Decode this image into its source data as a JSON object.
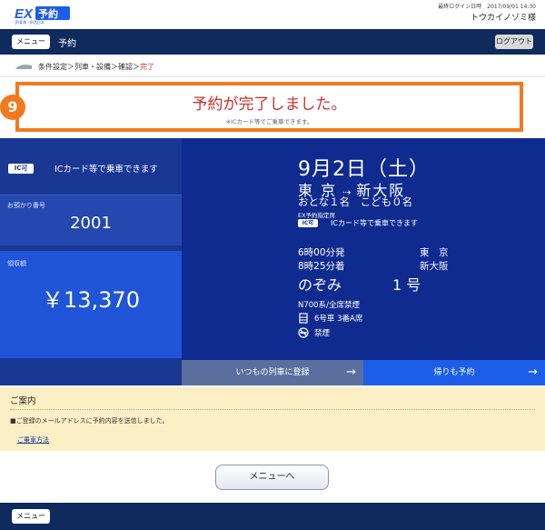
{
  "header": {
    "logo_text": "EX予約",
    "last_login": "最終ログイン日時　2017/09/01 14:30",
    "user_name": "トウカイノゾミ様"
  },
  "nav": {
    "menu_label": "メニュー",
    "title": "予約",
    "logout_label": "ログアウト"
  },
  "breadcrumb": {
    "steps_text": "条件設定＞列車・設備＞確認＞",
    "current": "完了"
  },
  "complete": {
    "step_number": "9",
    "title": "予約が完了しました。",
    "note": "※ICカード等でご乗車できます。"
  },
  "ticket": {
    "ic_badge": "IC可",
    "ic_text": "ICカード等で乗車できます",
    "deposit_label": "お預かり番号",
    "deposit_value": "2001",
    "amount_label": "領収額",
    "amount_value": "￥13,370",
    "date": "9月2日（土）",
    "from": "東 京",
    "to": "新大阪",
    "passengers": "おとな１名　こども０名",
    "seat_class": "EX予約指定席",
    "ic_line_text": "ICカード等で乗車できます",
    "depart_time": "6時00分発",
    "arrive_time": "8時25分着",
    "depart_station": "東　京",
    "arrive_station": "新大阪",
    "train_name": "のぞみ",
    "train_number": "1 号",
    "train_type": "N700系/全席禁煙",
    "seat_info": "6号車 3番A席",
    "smoking": "禁煙",
    "regular_button": "いつもの列車に登録",
    "return_button": "帰りも予約"
  },
  "guide": {
    "title": "ご案内",
    "text": "■ご登録のメールアドレスに予約内容を送信しました。",
    "link": "ご乗車方法"
  },
  "menu_back_label": "メニューへ",
  "footer": {
    "menu_label": "メニュー"
  },
  "colors": {
    "navy": "#0f2a5c",
    "ticket_blue": "#1a3794",
    "accent_orange": "#f07a1f",
    "complete_red": "#c9302c",
    "guide_bg": "#fbefc6"
  }
}
